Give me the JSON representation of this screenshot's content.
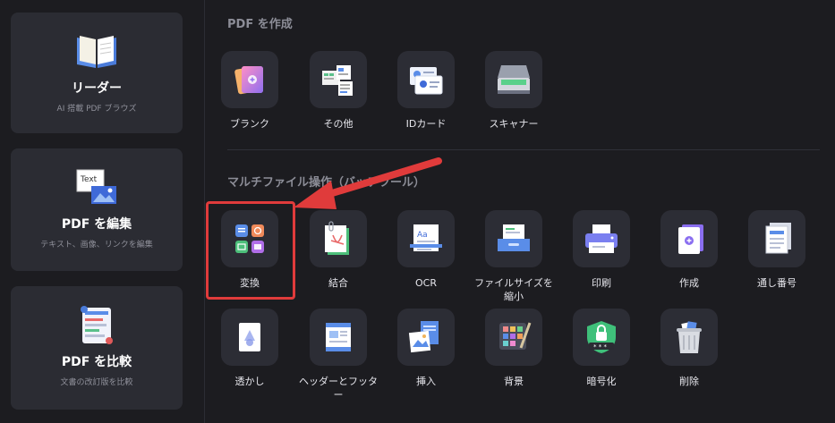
{
  "left_cards": [
    {
      "title": "リーダー",
      "subtitle": "AI 搭載 PDF ブラウズ",
      "icon": "book-icon"
    },
    {
      "title": "PDF を編集",
      "subtitle": "テキスト、画像、リンクを編集",
      "icon": "edit-text-icon",
      "icon_text": "Text"
    },
    {
      "title": "PDF を比較",
      "subtitle": "文書の改訂版を比較",
      "icon": "compare-icon"
    }
  ],
  "sections": {
    "create_title": "PDF を作成",
    "batch_title": "マルチファイル操作（バッチツール）"
  },
  "create_tools": [
    {
      "label": "ブランク",
      "icon": "blank-doc-icon"
    },
    {
      "label": "その他",
      "icon": "other-files-icon"
    },
    {
      "label": "IDカード",
      "icon": "id-card-icon"
    },
    {
      "label": "スキャナー",
      "icon": "scanner-icon"
    }
  ],
  "batch_tools_row1": [
    {
      "label": "変換",
      "icon": "convert-icon"
    },
    {
      "label": "結合",
      "icon": "combine-icon"
    },
    {
      "label": "OCR",
      "icon": "ocr-icon"
    },
    {
      "label": "ファイルサイズを縮小",
      "icon": "compress-icon"
    },
    {
      "label": "印刷",
      "icon": "print-icon"
    },
    {
      "label": "作成",
      "icon": "create-icon"
    },
    {
      "label": "通し番号",
      "icon": "bates-number-icon"
    }
  ],
  "batch_tools_row2": [
    {
      "label": "透かし",
      "icon": "watermark-icon"
    },
    {
      "label": "ヘッダーとフッター",
      "icon": "header-footer-icon"
    },
    {
      "label": "挿入",
      "icon": "insert-icon"
    },
    {
      "label": "背景",
      "icon": "background-icon"
    },
    {
      "label": "暗号化",
      "icon": "encrypt-icon"
    },
    {
      "label": "削除",
      "icon": "delete-icon"
    }
  ],
  "colors": {
    "background": "#1c1c20",
    "card": "#2b2c33",
    "tile": "#2c2d35",
    "highlight": "#e03b3b"
  }
}
